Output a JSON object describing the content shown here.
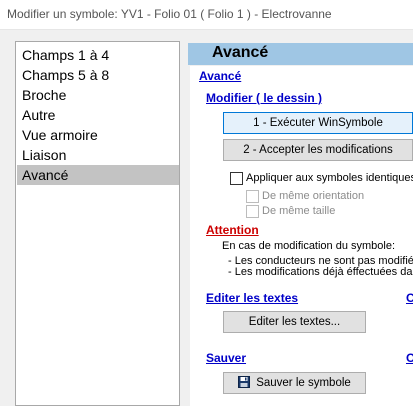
{
  "window": {
    "title": "Modifier un symbole: YV1 - Folio 01 ( Folio 1 ) - Electrovanne"
  },
  "sidebar": {
    "items": [
      {
        "label": "Champs 1 à 4"
      },
      {
        "label": "Champs 5 à 8"
      },
      {
        "label": "Broche"
      },
      {
        "label": "Autre"
      },
      {
        "label": "Vue armoire"
      },
      {
        "label": "Liaison"
      },
      {
        "label": "Avancé"
      }
    ],
    "selected": "Avancé"
  },
  "panel": {
    "header_title": "Avancé",
    "section_title": "Avancé",
    "modify_link": "Modifier ( le dessin )",
    "execute_button": "1 - Exécuter WinSymbole",
    "accept_button": "2 - Accepter les modifications",
    "apply_identical_label": "Appliquer aux symboles identiques (",
    "same_orientation_label": "De même orientation",
    "same_size_label": "De même taille",
    "attention_label": "Attention",
    "attention_line1": "En cas de modification du symbole:",
    "attention_line2": "- Les conducteurs ne sont pas modifié",
    "attention_line3": "- Les modifications déjà éffectuées da",
    "edit_texts_link": "Editer les textes",
    "edit_texts_right_link": "C",
    "edit_texts_button": "Editer les textes...",
    "save_link": "Sauver",
    "save_right_link": "O",
    "save_button": "Sauver le symbole"
  },
  "colors": {
    "header_bg": "#9fc6e4",
    "link": "#0000c8",
    "attention": "#cc0000",
    "selected_item": "#c3c3c3",
    "focused_button": "#e5f1fb"
  },
  "icons": {
    "save_button_icon": "floppy-disk-icon"
  }
}
